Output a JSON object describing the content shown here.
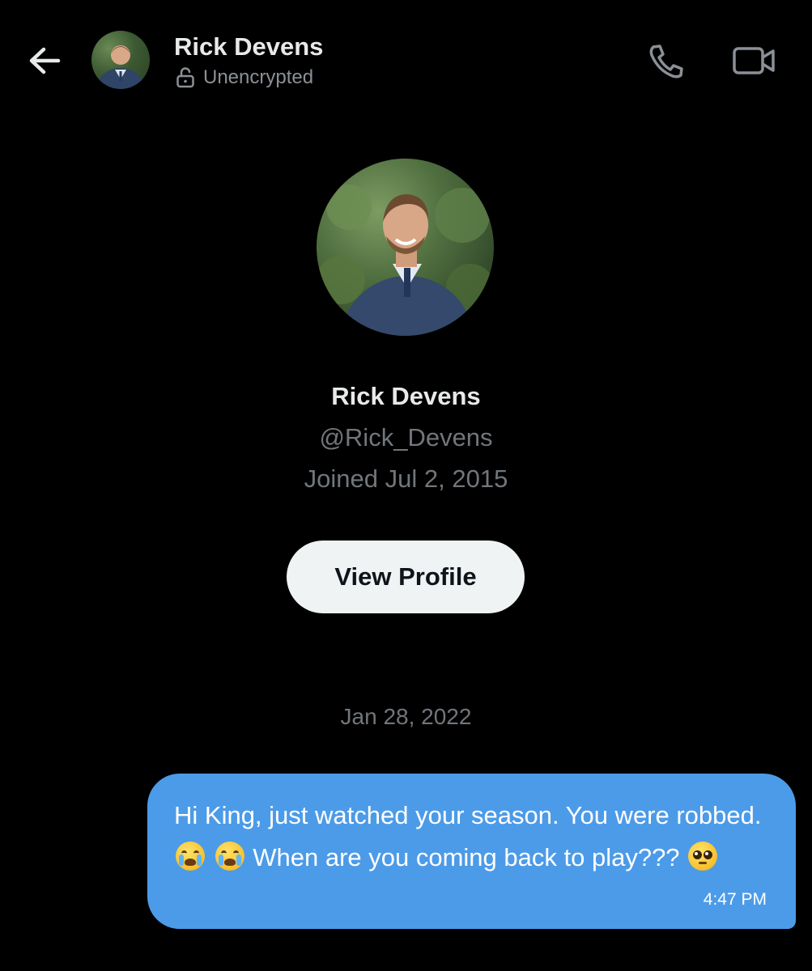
{
  "header": {
    "name": "Rick Devens",
    "status": "Unencrypted"
  },
  "profile": {
    "name": "Rick Devens",
    "handle": "@Rick_Devens",
    "joined": "Joined Jul 2, 2015",
    "view_profile_label": "View Profile"
  },
  "conversation": {
    "date_separator": "Jan 28, 2022",
    "messages": [
      {
        "text_part1": "Hi King, just watched your season. You were robbed.",
        "text_part2": "When are you coming back to play???",
        "time": "4:47 PM"
      }
    ]
  },
  "colors": {
    "background": "#000000",
    "bubble": "#4c9be8",
    "button": "#eff3f4",
    "muted_text": "#71767b"
  }
}
